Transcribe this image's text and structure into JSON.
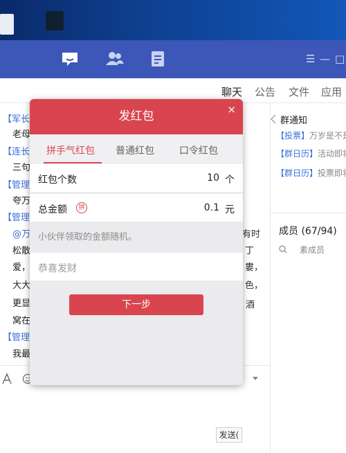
{
  "titlebar": {
    "controls": [
      "☰",
      "—",
      "□"
    ]
  },
  "topnav": {
    "tabs": [
      "聊天",
      "公告",
      "文件",
      "应用"
    ]
  },
  "chat": {
    "lines": [
      {
        "tag": "【军长】",
        "text": ""
      },
      {
        "tag": "",
        "text": "老母"
      },
      {
        "tag": "【连长】",
        "text": ""
      },
      {
        "tag": "",
        "text": "三句"
      },
      {
        "tag": "【管理员",
        "text": ""
      },
      {
        "tag": "",
        "text": "夸万"
      },
      {
        "tag": "【管理员",
        "text": ""
      },
      {
        "tag": "@万",
        "text": ""
      },
      {
        "tag": "",
        "text": "松散"
      },
      {
        "tag": "",
        "text": "爱，"
      },
      {
        "tag": "",
        "text": "大大"
      },
      {
        "tag": "",
        "text": "更显"
      },
      {
        "tag": "",
        "text": "窝在"
      },
      {
        "tag": "【管理员",
        "text": ""
      },
      {
        "tag": "",
        "text": "我最"
      }
    ],
    "right_fragments": [
      "有时",
      "丁",
      "婁，",
      "色，",
      "酒"
    ]
  },
  "inputbar": {
    "send_label": "发送("
  },
  "right_panel": {
    "notice_title": "群通知",
    "notices": [
      {
        "tag": "【投票】",
        "text": "万岁是不是"
      },
      {
        "tag": "【群日历】",
        "text": "活动即将"
      },
      {
        "tag": "【群日历】",
        "text": "投票即将"
      }
    ],
    "members_title": "成员 (67/94)",
    "member_search": "素成员"
  },
  "dialog": {
    "title": "发红包",
    "close": "×",
    "tabs": [
      "拼手气红包",
      "普通红包",
      "口令红包"
    ],
    "count_label": "红包个数",
    "count_value": "10",
    "count_unit": "个",
    "amount_label": "总金额",
    "amount_badge": "拼",
    "amount_value": "0.1",
    "amount_unit": "元",
    "hint": "小伙伴领取的金额随机。",
    "greeting": "恭喜发财",
    "next_label": "下一步"
  },
  "colors": {
    "accent": "#d9454f",
    "titlebar": "#3c57b8",
    "link": "#3c6fd8"
  }
}
